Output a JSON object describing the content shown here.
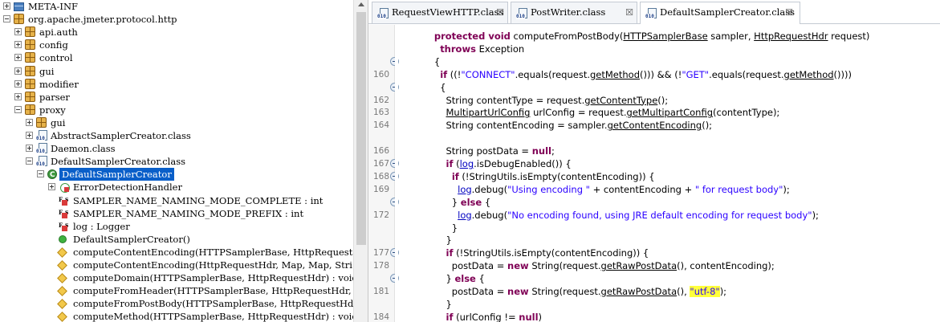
{
  "tree": {
    "rows": [
      {
        "label": "META-INF",
        "icon": "folder",
        "twisty": "plus",
        "indent": 0
      },
      {
        "label": "org.apache.jmeter.protocol.http",
        "icon": "package",
        "twisty": "minus",
        "indent": 0
      },
      {
        "label": "api.auth",
        "icon": "package",
        "twisty": "plus",
        "indent": 1
      },
      {
        "label": "config",
        "icon": "package",
        "twisty": "plus",
        "indent": 1
      },
      {
        "label": "control",
        "icon": "package",
        "twisty": "plus",
        "indent": 1
      },
      {
        "label": "gui",
        "icon": "package",
        "twisty": "plus",
        "indent": 1
      },
      {
        "label": "modifier",
        "icon": "package",
        "twisty": "plus",
        "indent": 1
      },
      {
        "label": "parser",
        "icon": "package",
        "twisty": "plus",
        "indent": 1
      },
      {
        "label": "proxy",
        "icon": "package",
        "twisty": "minus",
        "indent": 1
      },
      {
        "label": "gui",
        "icon": "package",
        "twisty": "plus",
        "indent": 2
      },
      {
        "label": "AbstractSamplerCreator.class",
        "icon": "classfile",
        "twisty": "plus",
        "indent": 2
      },
      {
        "label": "Daemon.class",
        "icon": "classfile",
        "twisty": "plus",
        "indent": 2
      },
      {
        "label": "DefaultSamplerCreator.class",
        "icon": "classfile",
        "twisty": "minus",
        "indent": 2
      },
      {
        "label": "DefaultSamplerCreator",
        "icon": "class",
        "twisty": "minus",
        "indent": 3,
        "selected": true
      },
      {
        "label": "ErrorDetectionHandler",
        "icon": "inner-class",
        "twisty": "plus",
        "indent": 4
      },
      {
        "label": "SAMPLER_NAME_NAMING_MODE_COMPLETE : int",
        "icon": "static-final-field",
        "twisty": "none",
        "indent": 4
      },
      {
        "label": "SAMPLER_NAME_NAMING_MODE_PREFIX : int",
        "icon": "static-final-field",
        "twisty": "none",
        "indent": 4
      },
      {
        "label": "log : Logger",
        "icon": "static-final-field",
        "twisty": "none",
        "indent": 4
      },
      {
        "label": "DefaultSamplerCreator()",
        "icon": "constructor",
        "twisty": "none",
        "indent": 4
      },
      {
        "label": "computeContentEncoding(HTTPSamplerBase, HttpRequestHd",
        "icon": "method",
        "twisty": "none",
        "indent": 4
      },
      {
        "label": "computeContentEncoding(HttpRequestHdr, Map, Map, Stri",
        "icon": "method",
        "twisty": "none",
        "indent": 4
      },
      {
        "label": "computeDomain(HTTPSamplerBase, HttpRequestHdr) : void",
        "icon": "method",
        "twisty": "none",
        "indent": 4
      },
      {
        "label": "computeFromHeader(HTTPSamplerBase, HttpRequestHdr, Ma",
        "icon": "method",
        "twisty": "none",
        "indent": 4
      },
      {
        "label": "computeFromPostBody(HTTPSamplerBase, HttpRequestHdr)",
        "icon": "method",
        "twisty": "none",
        "indent": 4
      },
      {
        "label": "computeMethod(HTTPSamplerBase, HttpRequestHdr) : void",
        "icon": "method",
        "twisty": "none",
        "indent": 4
      }
    ]
  },
  "editor": {
    "tabs": [
      {
        "label": "RequestViewHTTP.class",
        "close": "☒",
        "active": false
      },
      {
        "label": "PostWriter.class",
        "close": "☒",
        "active": false
      },
      {
        "label": "DefaultSamplerCreator.class",
        "close": "☒",
        "active": true
      }
    ],
    "lines": [
      {
        "num": "",
        "fold": false,
        "html": "  <span class=\"kw\">protected void</span> computeFromPostBody(<span class=\"u\">HTTPSamplerBase</span> sampler, <span class=\"u\">HttpRequestHdr</span> request)"
      },
      {
        "num": "",
        "fold": false,
        "html": "    <span class=\"kw\">throws</span> Exception"
      },
      {
        "num": "",
        "fold": true,
        "html": "  {"
      },
      {
        "num": "160",
        "fold": false,
        "html": "    <span class=\"kw\">if</span> ((!<span class=\"str\">\"CONNECT\"</span>.equals(request.<span class=\"u\">getMethod</span>())) &amp;&amp; (!<span class=\"str\">\"GET\"</span>.equals(request.<span class=\"u\">getMethod</span>())))"
      },
      {
        "num": "",
        "fold": true,
        "html": "    {"
      },
      {
        "num": "162",
        "fold": false,
        "html": "      String contentType = request.<span class=\"u\">getContentType</span>();"
      },
      {
        "num": "163",
        "fold": false,
        "html": "      <span class=\"u\">MultipartUrlConfig</span> urlConfig = request.<span class=\"u\">getMultipartConfig</span>(contentType);"
      },
      {
        "num": "164",
        "fold": false,
        "html": "      String contentEncoding = sampler.<span class=\"u\">getContentEncoding</span>();"
      },
      {
        "num": "",
        "fold": false,
        "html": ""
      },
      {
        "num": "166",
        "fold": false,
        "html": "      String postData = <span class=\"kw\">null</span>;"
      },
      {
        "num": "167",
        "fold": true,
        "html": "      <span class=\"kw\">if</span> (<span class=\"fieldref u\">log</span>.isDebugEnabled()) {"
      },
      {
        "num": "168",
        "fold": true,
        "html": "        <span class=\"kw\">if</span> (!StringUtils.isEmpty(contentEncoding)) {"
      },
      {
        "num": "169",
        "fold": false,
        "html": "          <span class=\"fieldref u\">log</span>.debug(<span class=\"str\">\"Using encoding \"</span> + contentEncoding + <span class=\"str\">\" for request body\"</span>);"
      },
      {
        "num": "",
        "fold": true,
        "html": "        } <span class=\"kw\">else</span> {"
      },
      {
        "num": "172",
        "fold": false,
        "html": "          <span class=\"fieldref u\">log</span>.debug(<span class=\"str\">\"No encoding found, using JRE default encoding for request body\"</span>);"
      },
      {
        "num": "",
        "fold": false,
        "html": "        }"
      },
      {
        "num": "",
        "fold": false,
        "html": "      }"
      },
      {
        "num": "177",
        "fold": true,
        "html": "      <span class=\"kw\">if</span> (!StringUtils.isEmpty(contentEncoding)) {"
      },
      {
        "num": "178",
        "fold": false,
        "html": "        postData = <span class=\"kw\">new</span> String(request.<span class=\"u\">getRawPostData</span>(), contentEncoding);"
      },
      {
        "num": "",
        "fold": true,
        "html": "      } <span class=\"kw\">else</span> {"
      },
      {
        "num": "181",
        "fold": false,
        "html": "        postData = <span class=\"kw\">new</span> String(request.<span class=\"u\">getRawPostData</span>(), <span class=\"str hl\">\"utf-8\"</span>);"
      },
      {
        "num": "",
        "fold": false,
        "html": "      }"
      },
      {
        "num": "184",
        "fold": false,
        "html": "      <span class=\"kw\">if</span> (urlConfig != <span class=\"kw\">null</span>)"
      },
      {
        "num": "",
        "fold": true,
        "html": "      {"
      }
    ]
  }
}
